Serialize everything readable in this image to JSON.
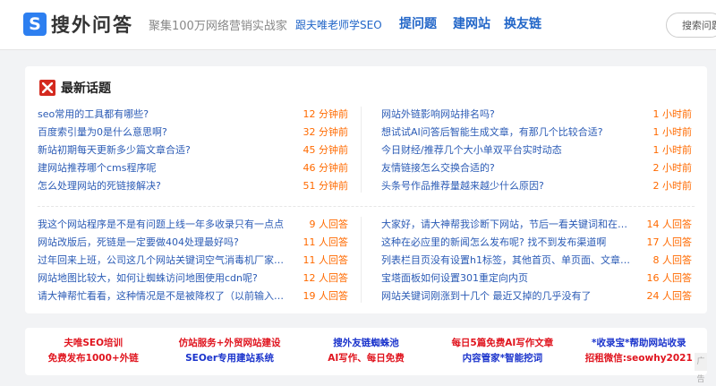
{
  "header": {
    "logo_mark": "S",
    "logo_text": "搜外问答",
    "slogan": "聚集100万网络营销实战家",
    "follow_link": "跟夫唯老师学SEO",
    "nav": [
      "提问题",
      "建网站",
      "换友链"
    ],
    "search_placeholder": "搜索问题"
  },
  "latest": {
    "title": "最新话题",
    "icon": "x-logo-icon",
    "left": [
      {
        "q": "seo常用的工具都有哪些?",
        "meta": "12 分钟前"
      },
      {
        "q": "百度索引量为0是什么意思啊?",
        "meta": "32 分钟前"
      },
      {
        "q": "新站初期每天更新多少篇文章合适?",
        "meta": "45 分钟前"
      },
      {
        "q": "建网站推荐哪个cms程序呢",
        "meta": "46 分钟前"
      },
      {
        "q": "怎么处理网站的死链接解决?",
        "meta": "51 分钟前"
      }
    ],
    "right": [
      {
        "q": "网站外链影响网站排名吗?",
        "meta": "1 小时前"
      },
      {
        "q": "想试试AI问答后智能生成文章，有那几个比较合适?",
        "meta": "1 小时前"
      },
      {
        "q": "今日财经/推荐几个大小单双平台实时动态",
        "meta": "1 小时前"
      },
      {
        "q": "友情链接怎么交换合适的?",
        "meta": "2 小时前"
      },
      {
        "q": "头条号作品推荐量越来越少什么原因?",
        "meta": "2 小时前"
      }
    ]
  },
  "answered": {
    "left": [
      {
        "q": "我这个网站程序是不是有问题上线一年多收录只有一点点",
        "meta": "9 人回答"
      },
      {
        "q": "网站改版后，死链是一定要做404处理最好吗?",
        "meta": "11 人回答"
      },
      {
        "q": "过年回来上班，公司这几个网站关键词空气消毒机厂家、…",
        "meta": "11 人回答"
      },
      {
        "q": "网站地图比较大，如何让蜘蛛访问地图使用cdn呢?",
        "meta": "12 人回答"
      },
      {
        "q": "请大神帮忙看看，这种情况是不是被降权了（以前输入主…",
        "meta": "19 人回答"
      }
    ],
    "right": [
      {
        "q": "大家好，请大神帮我诊断下网站，节后一看关键词和在百…",
        "meta": "14 人回答"
      },
      {
        "q": "这种在必应里的新闻怎么发布呢? 找不到发布渠道啊",
        "meta": "17 人回答"
      },
      {
        "q": "列表栏目页没有设置h1标签，其他首页、单页面、文章内…",
        "meta": "8 人回答"
      },
      {
        "q": "宝塔面板如何设置301重定向内页",
        "meta": "16 人回答"
      },
      {
        "q": "网站关键词刚涨到十几个 最近又掉的几乎没有了",
        "meta": "24 人回答"
      }
    ]
  },
  "ads": [
    {
      "l1": "夫唯SEO培训",
      "l2": "免费发布1000+外链",
      "c1": "#e0141e",
      "c2": "#e0141e"
    },
    {
      "l1": "仿站服务+外贸网站建设",
      "l2": "SEOer专用建站系统",
      "c1": "#e0141e",
      "c2": "#1a33cc"
    },
    {
      "l1": "搜外友链蜘蛛池",
      "l2": "AI写作、每日免费",
      "c1": "#1a33cc",
      "c2": "#e0141e"
    },
    {
      "l1": "每日5篇免费AI写作文章",
      "l2": "内容管家*智能挖词",
      "c1": "#e0141e",
      "c2": "#1a33cc"
    },
    {
      "l1": "*收录宝*帮助网站收录",
      "l2": "招租微信:seowhy2021",
      "c1": "#1a33cc",
      "c2": "#e0141e"
    }
  ],
  "ad_badge": "广告",
  "colors": {
    "accent": "#2266c8",
    "time": "#ff6a00",
    "link": "#2b5bb5",
    "brand_red": "#d42a1f"
  }
}
